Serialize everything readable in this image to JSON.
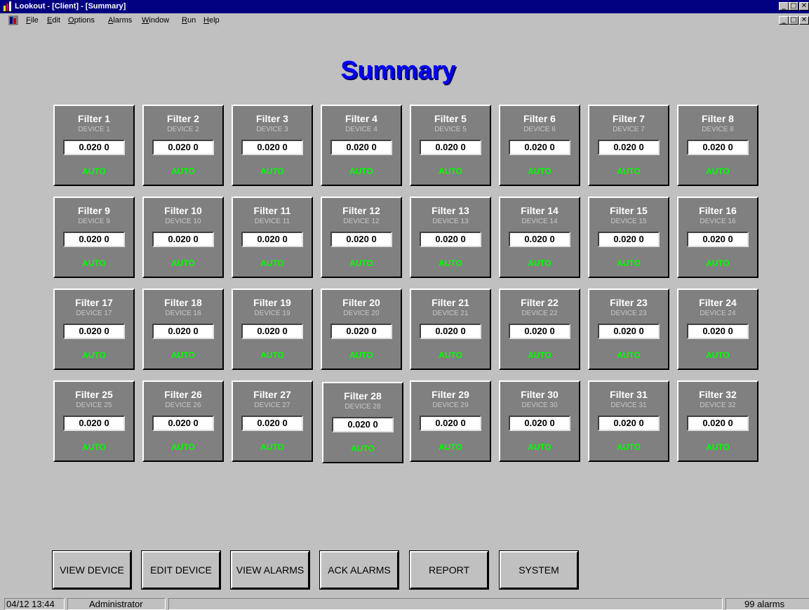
{
  "window": {
    "title": "Lookout - [Client] - [Summary]",
    "controls": [
      "_",
      "□",
      "✕"
    ]
  },
  "menu": [
    {
      "label": "File",
      "u": "F",
      "rest": "ile"
    },
    {
      "label": "Edit",
      "u": "E",
      "rest": "dit"
    },
    {
      "label": "Options",
      "u": "O",
      "rest": "ptions"
    },
    {
      "label": "Alarms",
      "u": "A",
      "rest": "larms"
    },
    {
      "label": "Window",
      "u": "W",
      "rest": "indow"
    },
    {
      "label": "Run",
      "u": "R",
      "rest": "un"
    },
    {
      "label": "Help",
      "u": "H",
      "rest": "elp"
    }
  ],
  "page_title": "Summary",
  "filters": [
    {
      "name": "Filter 1",
      "device": "DEVICE 1",
      "value": "0.020 0",
      "mode": "AUTO"
    },
    {
      "name": "Filter 2",
      "device": "DEVICE 2",
      "value": "0.020 0",
      "mode": "AUTO"
    },
    {
      "name": "Filter 3",
      "device": "DEVICE 3",
      "value": "0.020 0",
      "mode": "AUTO"
    },
    {
      "name": "Filter 4",
      "device": "DEVICE 4",
      "value": "0.020 0",
      "mode": "AUTO"
    },
    {
      "name": "Filter 5",
      "device": "DEVICE 5",
      "value": "0.020 0",
      "mode": "AUTO"
    },
    {
      "name": "Filter 6",
      "device": "DEVICE 6",
      "value": "0.020 0",
      "mode": "AUTO"
    },
    {
      "name": "Filter 7",
      "device": "DEVICE 7",
      "value": "0.020 0",
      "mode": "AUTO"
    },
    {
      "name": "Filter 8",
      "device": "DEVICE 8",
      "value": "0.020 0",
      "mode": "AUTO"
    },
    {
      "name": "Filter 9",
      "device": "DEVICE 9",
      "value": "0.020 0",
      "mode": "AUTO"
    },
    {
      "name": "Filter 10",
      "device": "DEVICE 10",
      "value": "0.020 0",
      "mode": "AUTO"
    },
    {
      "name": "Filter 11",
      "device": "DEVICE 11",
      "value": "0.020 0",
      "mode": "AUTO"
    },
    {
      "name": "Filter 12",
      "device": "DEVICE 12",
      "value": "0.020 0",
      "mode": "AUTO"
    },
    {
      "name": "Filter 13",
      "device": "DEVICE 13",
      "value": "0.020 0",
      "mode": "AUTO"
    },
    {
      "name": "Filter 14",
      "device": "DEVICE 14",
      "value": "0.020 0",
      "mode": "AUTO"
    },
    {
      "name": "Filter 15",
      "device": "DEVICE 15",
      "value": "0.020 0",
      "mode": "AUTO"
    },
    {
      "name": "Filter 16",
      "device": "DEVICE 16",
      "value": "0.020 0",
      "mode": "AUTO"
    },
    {
      "name": "Filter 17",
      "device": "DEVICE 17",
      "value": "0.020 0",
      "mode": "AUTO"
    },
    {
      "name": "Filter 18",
      "device": "DEVICE 18",
      "value": "0.020 0",
      "mode": "AUTO"
    },
    {
      "name": "Filter 19",
      "device": "DEVICE 19",
      "value": "0.020 0",
      "mode": "AUTO"
    },
    {
      "name": "Filter 20",
      "device": "DEVICE 20",
      "value": "0.020 0",
      "mode": "AUTO"
    },
    {
      "name": "Filter 21",
      "device": "DEVICE 21",
      "value": "0.020 0",
      "mode": "AUTO"
    },
    {
      "name": "Filter 22",
      "device": "DEVICE 22",
      "value": "0.020 0",
      "mode": "AUTO"
    },
    {
      "name": "Filter 23",
      "device": "DEVICE 23",
      "value": "0.020 0",
      "mode": "AUTO"
    },
    {
      "name": "Filter 24",
      "device": "DEVICE 24",
      "value": "0.020 0",
      "mode": "AUTO"
    },
    {
      "name": "Filter 25",
      "device": "DEVICE 25",
      "value": "0.020 0",
      "mode": "AUTO"
    },
    {
      "name": "Filter 26",
      "device": "DEVICE 26",
      "value": "0.020 0",
      "mode": "AUTO"
    },
    {
      "name": "Filter 27",
      "device": "DEVICE 27",
      "value": "0.020 0",
      "mode": "AUTO"
    },
    {
      "name": "Filter 28",
      "device": "DEVICE 28",
      "value": "0.020 0",
      "mode": "AUTO"
    },
    {
      "name": "Filter 29",
      "device": "DEVICE 29",
      "value": "0.020 0",
      "mode": "AUTO"
    },
    {
      "name": "Filter 30",
      "device": "DEVICE 30",
      "value": "0.020 0",
      "mode": "AUTO"
    },
    {
      "name": "Filter 31",
      "device": "DEVICE 31",
      "value": "0.020 0",
      "mode": "AUTO"
    },
    {
      "name": "Filter 32",
      "device": "DEVICE 32",
      "value": "0.020 0",
      "mode": "AUTO"
    }
  ],
  "buttons": [
    "VIEW DEVICE",
    "EDIT DEVICE",
    "VIEW ALARMS",
    "ACK ALARMS",
    "REPORT",
    "SYSTEM"
  ],
  "status": {
    "datetime": "04/12 13:44",
    "user": "Administrator",
    "message": "",
    "alarms": "99 alarms"
  },
  "colors": {
    "title_bar": "#000080",
    "page_title": "#0000ff",
    "tile": "#808080",
    "mode_auto": "#00ff00"
  }
}
